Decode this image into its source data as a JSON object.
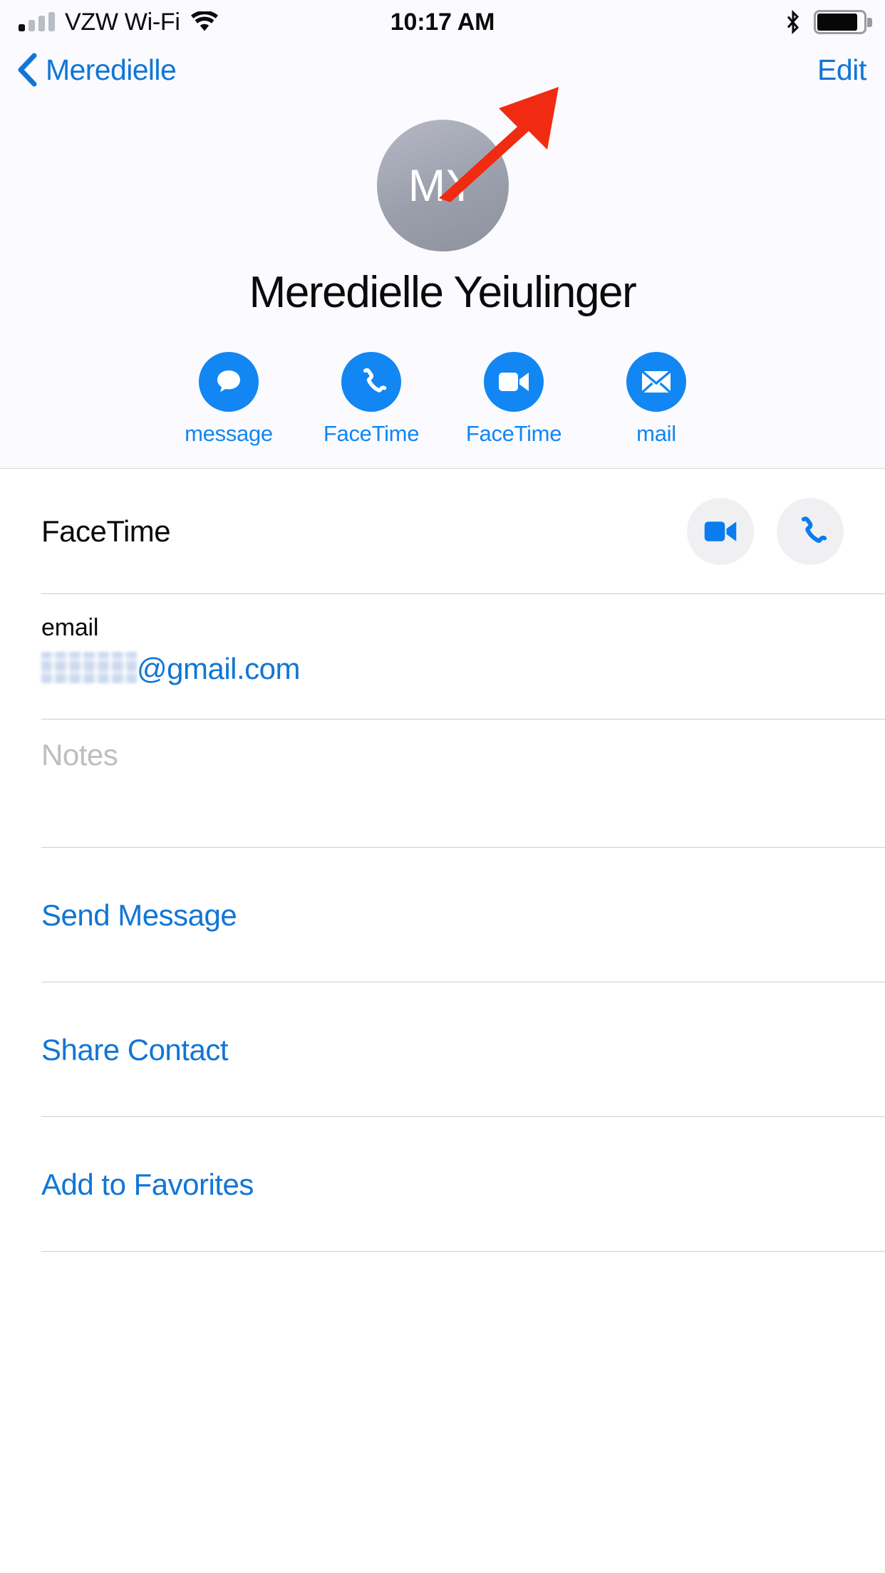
{
  "status_bar": {
    "carrier": "VZW Wi-Fi",
    "time": "10:17 AM",
    "signal_bars_filled": 1,
    "signal_bars_total": 4,
    "wifi_icon": "wifi-icon",
    "bluetooth_icon": "bluetooth-icon",
    "battery_icon": "battery-full-icon"
  },
  "nav": {
    "back_icon": "chevron-left-icon",
    "back_label": "Meredielle",
    "edit_label": "Edit"
  },
  "contact": {
    "initials": "MY",
    "full_name": "Meredielle Yeiulinger",
    "avatar_name": "contact-avatar"
  },
  "quick_actions": [
    {
      "label": "message",
      "icon": "message-bubble-icon"
    },
    {
      "label": "FaceTime",
      "icon": "phone-handset-icon"
    },
    {
      "label": "FaceTime",
      "icon": "video-camera-icon"
    },
    {
      "label": "mail",
      "icon": "envelope-icon"
    }
  ],
  "rows": {
    "facetime": {
      "label": "FaceTime",
      "video_icon": "video-camera-icon",
      "audio_icon": "phone-handset-icon"
    },
    "email": {
      "label": "email",
      "value_redacted": true,
      "domain": "@gmail.com"
    },
    "notes": {
      "placeholder": "Notes"
    }
  },
  "links": [
    {
      "label": "Send Message"
    },
    {
      "label": "Share Contact"
    },
    {
      "label": "Add to Favorites"
    }
  ],
  "annotation": {
    "type": "arrow",
    "points_to": "Edit",
    "color": "#f02b11"
  },
  "colors": {
    "accent_blue": "#1076d6",
    "action_blue": "#1286f2",
    "header_bg": "#fafaff",
    "separator": "#cfcfd4",
    "annotation_red": "#f02b11"
  }
}
